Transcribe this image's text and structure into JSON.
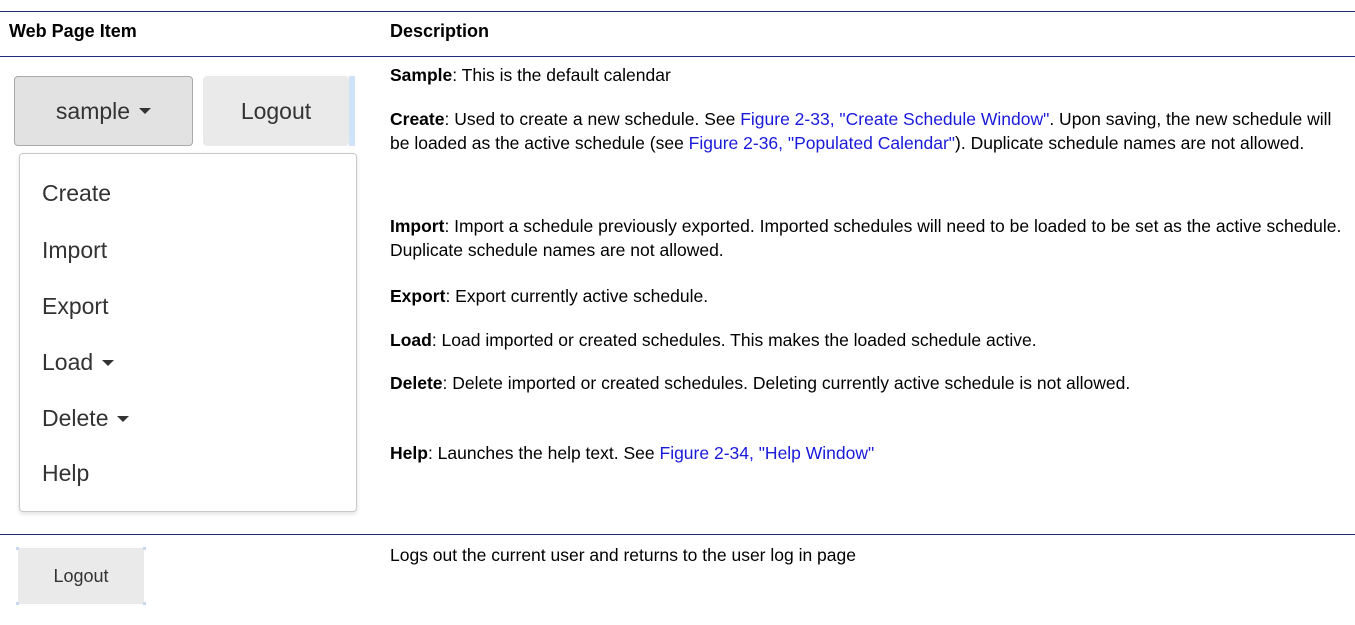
{
  "table": {
    "header": {
      "col1": "Web Page Item",
      "col2": "Description"
    },
    "row1": {
      "widget": {
        "sample_button": "sample",
        "logout_button": "Logout",
        "menu_items": [
          "Create",
          "Import",
          "Export",
          "Load",
          "Delete",
          "Help"
        ]
      },
      "desc": {
        "sample_term": "Sample",
        "sample_text": ": This is the default calendar",
        "create_term": "Create",
        "create_text_1": ": Used to create a new schedule. See ",
        "create_link_1": "Figure 2-33, \"Create Schedule Window\"",
        "create_text_2": ". Upon saving, the new schedule will be loaded as the active schedule (see ",
        "create_link_2": "Figure 2-36, \"Populated Calendar\"",
        "create_text_3": "). Duplicate schedule names are not allowed.",
        "import_term": "Import",
        "import_text": ": Import a schedule previously exported. Imported schedules will need to be loaded to be set as the active schedule. Duplicate schedule names are not allowed.",
        "export_term": "Export",
        "export_text": ": Export currently active schedule.",
        "load_term": "Load",
        "load_text": ": Load imported or created schedules. This makes the loaded schedule active.",
        "delete_term": "Delete",
        "delete_text": ": Delete imported or created schedules. Deleting currently active schedule is not allowed.",
        "help_term": "Help",
        "help_text": ": Launches the help text. See ",
        "help_link": "Figure 2-34, \"Help Window\""
      }
    },
    "row2": {
      "logout_button": "Logout",
      "description": "Logs out the current user and returns to the user log in page"
    }
  },
  "colors": {
    "rule": "#1f2a7a",
    "link": "#1a1adb",
    "button_bg": "#e2e2e2"
  }
}
